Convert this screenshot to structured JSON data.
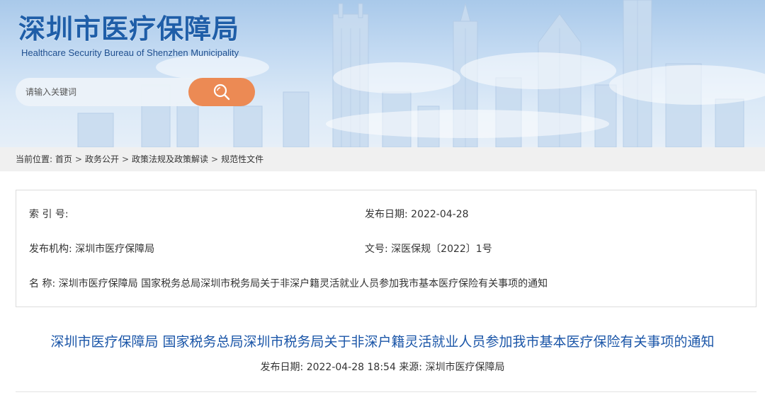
{
  "header": {
    "title": "深圳市医疗保障局",
    "subtitle": "Healthcare Security Bureau of Shenzhen Municipality"
  },
  "search": {
    "placeholder": "请输入关键词",
    "button_icon": "search-icon"
  },
  "breadcrumb": {
    "prefix": "当前位置:",
    "items": [
      "首页",
      "政务公开",
      "政策法规及政策解读",
      "规范性文件"
    ],
    "separator": ">"
  },
  "info": {
    "index_label": "索 引 号:",
    "index_value": "",
    "date_label": "发布日期:",
    "date_value": "2022-04-28",
    "org_label": "发布机构:",
    "org_value": "深圳市医疗保障局",
    "docno_label": "文号:",
    "docno_value": "深医保规〔2022〕1号",
    "name_label": "名 称:",
    "name_value": "深圳市医疗保障局 国家税务总局深圳市税务局关于非深户籍灵活就业人员参加我市基本医疗保险有关事项的通知"
  },
  "article": {
    "title": "深圳市医疗保障局 国家税务总局深圳市税务局关于非深户籍灵活就业人员参加我市基本医疗保险有关事项的通知",
    "date_label": "发布日期:",
    "date_value": "2022-04-28 18:54",
    "source_label": "来源:",
    "source_value": "深圳市医疗保障局"
  },
  "colors": {
    "title_blue": "#1f5ea8",
    "article_title_blue": "#1b56a8",
    "search_orange": "#ec8a54",
    "breadcrumb_bg": "#f0f0f0"
  }
}
